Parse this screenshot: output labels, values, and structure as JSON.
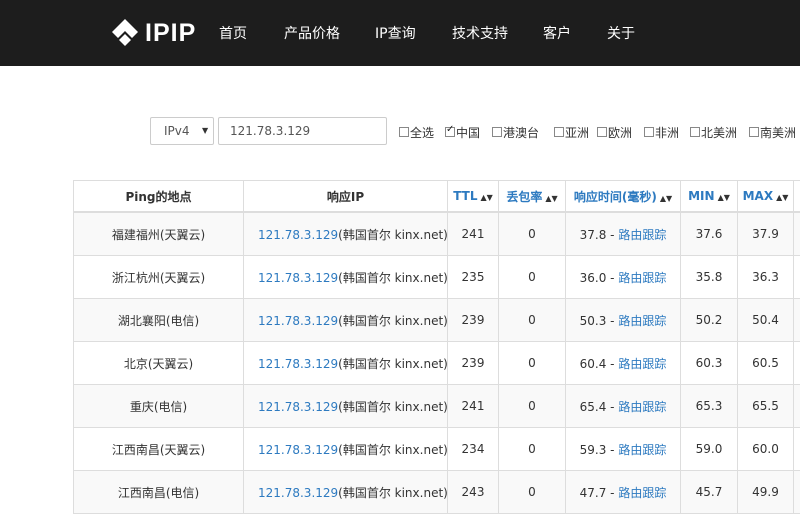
{
  "brand": {
    "name": "IPIP"
  },
  "nav": {
    "items": [
      "首页",
      "产品价格",
      "IP查询",
      "技术支持",
      "客户",
      "关于"
    ]
  },
  "search": {
    "ip_version": "IPv4",
    "ip_value": "121.78.3.129",
    "regions": [
      {
        "label": "全选",
        "checked": false
      },
      {
        "label": "中国",
        "checked": true
      },
      {
        "label": "港澳台",
        "checked": false
      },
      {
        "label": "亚洲",
        "checked": false
      },
      {
        "label": "欧洲",
        "checked": false
      },
      {
        "label": "非洲",
        "checked": false
      },
      {
        "label": "北美洲",
        "checked": false
      },
      {
        "label": "南美洲",
        "checked": false
      }
    ]
  },
  "table": {
    "headers": [
      "Ping的地点",
      "响应IP",
      "TTL",
      "丢包率",
      "响应时间(毫秒)",
      "MIN",
      "MAX"
    ],
    "trace_label": "路由跟踪",
    "rows": [
      {
        "location": "福建福州(天翼云)",
        "ip": "121.78.3.129",
        "ip_info": "(韩国首尔 kinx.net)",
        "ttl": "241",
        "loss": "0",
        "time": "37.8",
        "min": "37.6",
        "max": "37.9"
      },
      {
        "location": "浙江杭州(天翼云)",
        "ip": "121.78.3.129",
        "ip_info": "(韩国首尔 kinx.net)",
        "ttl": "235",
        "loss": "0",
        "time": "36.0",
        "min": "35.8",
        "max": "36.3"
      },
      {
        "location": "湖北襄阳(电信)",
        "ip": "121.78.3.129",
        "ip_info": "(韩国首尔 kinx.net)",
        "ttl": "239",
        "loss": "0",
        "time": "50.3",
        "min": "50.2",
        "max": "50.4"
      },
      {
        "location": "北京(天翼云)",
        "ip": "121.78.3.129",
        "ip_info": "(韩国首尔 kinx.net)",
        "ttl": "239",
        "loss": "0",
        "time": "60.4",
        "min": "60.3",
        "max": "60.5"
      },
      {
        "location": "重庆(电信)",
        "ip": "121.78.3.129",
        "ip_info": "(韩国首尔 kinx.net)",
        "ttl": "241",
        "loss": "0",
        "time": "65.4",
        "min": "65.3",
        "max": "65.5"
      },
      {
        "location": "江西南昌(天翼云)",
        "ip": "121.78.3.129",
        "ip_info": "(韩国首尔 kinx.net)",
        "ttl": "234",
        "loss": "0",
        "time": "59.3",
        "min": "59.0",
        "max": "60.0"
      },
      {
        "location": "江西南昌(电信)",
        "ip": "121.78.3.129",
        "ip_info": "(韩国首尔 kinx.net)",
        "ttl": "243",
        "loss": "0",
        "time": "47.7",
        "min": "45.7",
        "max": "49.9"
      }
    ]
  },
  "colors": {
    "topbar": "#1d1d1d",
    "link": "#2d7ac0",
    "row_stripe": "#f9f9f9"
  }
}
